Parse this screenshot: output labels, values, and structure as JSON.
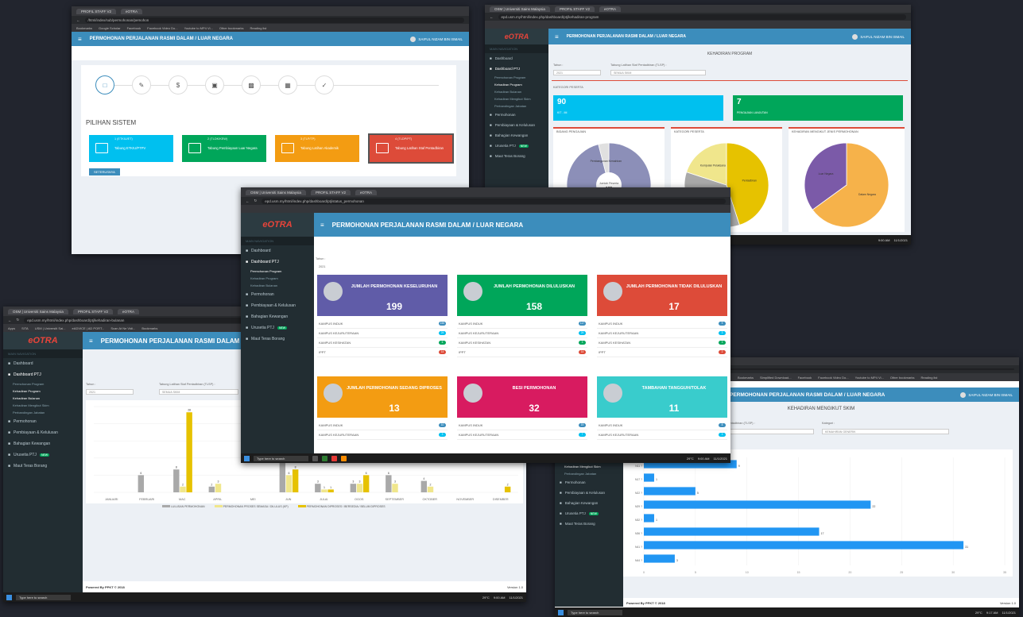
{
  "app": {
    "header_title": "PERMOHONAN PERJALANAN RASMI DALAM / LUAR NEGARA",
    "logo_text": "eOTRA",
    "user_name": "SAIFUL NIZAM BIN ISMAIL",
    "footer": "Powered By PPKT © 2018",
    "version": "Version 1.0",
    "accent_color": "#3c8dbc",
    "sidebar_bg": "#222d32"
  },
  "shot_a": {
    "tabs": [
      "PROFIL STAFF V2",
      "eOTRA"
    ],
    "url": "/html/index/sub/permohonan/pemohon",
    "bookmarks": [
      "Bookmarks",
      "Google Scholar",
      "Facebook",
      "Facebook Video Do...",
      "Youtube to MP4 Vi...",
      "Other bookmarks",
      "Reading list"
    ],
    "section_title": "PILIHAN SISTEM",
    "steps": [
      "file-icon",
      "pen-icon",
      "dollar-icon",
      "image-icon",
      "printer-icon",
      "calendar-icon",
      "check-icon"
    ],
    "cards": [
      {
        "head": "1 (ETKIU/ET)",
        "label": "Tabung ETKIU/PTPV",
        "color": "#00c0ef",
        "icon": "id-card-icon"
      },
      {
        "head": "2 (TLDK/KEW)",
        "label": "Tabung Pembiayaan Luar Negara",
        "color": "#00a65a",
        "icon": "calendar-check-icon"
      },
      {
        "head": "3 (TLP/TP)",
        "label": "Tabung Latihan Akademik",
        "color": "#f39c12",
        "icon": "document-icon"
      },
      {
        "head": "4 (TLDP/PT)",
        "label": "Tabung Latihan Staf Pentadbiran",
        "color": "#dd4b39",
        "icon": "calendar-icon"
      }
    ],
    "next_button": "SETERUSNYA"
  },
  "shot_b": {
    "tabs": [
      "OSM | Universiti Sains Malaysia",
      "PROFIL STAFF V2",
      "eOTRA"
    ],
    "url": "epd.usm.my/html/index.php/dashboard/ptj/kehadiran-program",
    "page_title": "KEHADIRAN PROGRAM",
    "filter_tahun": "Tahun :",
    "filter_tahun_value": "2021",
    "filter_tabung": "Tabung Latihan Staf Pentadbiran (TLSP) :",
    "filter_tabung_value": "SEMUA SKIM",
    "section": "KATEGORI PESERTA",
    "stats": [
      {
        "value": "90",
        "label": "KIT - IM",
        "color": "#00c0ef"
      },
      {
        "value": "7",
        "label": "PENGAJIAN LANJUTAN",
        "color": "#00a65a"
      }
    ],
    "charts": [
      {
        "title": "BIDANG PENGAJIAN",
        "center_label": "Jumlah Peserta",
        "center_value": "105"
      },
      {
        "title": "KATEGORI PESERTA",
        "center_label": "",
        "center_value": ""
      },
      {
        "title": "KEHADIRAN MENGIKUT JENIS PERMOHONAN",
        "center_label": "",
        "center_value": ""
      }
    ],
    "taskbar_search": "Type here to search",
    "time": "9:00 AM",
    "date": "11/1/2021"
  },
  "shot_c": {
    "tabs": [
      "OSM | Universiti Sains Malaysia",
      "PROFIL STAFF V2",
      "eOTRA"
    ],
    "url": "epd.usm.my/html/index.php/dashboard/ptj/status_permohonan",
    "tahun_label": "Tahun :",
    "tahun_value": "2021",
    "stat_cards": [
      {
        "title": "JUMLAH PERMOHONAN KESELURUHAN",
        "value": "199",
        "color": "#605ca8",
        "rows": [
          [
            "KAMPUS INDUK",
            "155"
          ],
          [
            "KAMPUS KEJURUTERAAN",
            "24"
          ],
          [
            "KAMPUS KESIHATAN",
            "6"
          ],
          [
            "IPPT",
            "14"
          ]
        ]
      },
      {
        "title": "JUMLAH PERMOHONAN DILULUSKAN",
        "value": "158",
        "color": "#00a65a",
        "rows": [
          [
            "KAMPUS INDUK",
            "117"
          ],
          [
            "KAMPUS KEJURUTERAAN",
            "24"
          ],
          [
            "KAMPUS KESIHATAN",
            "3"
          ],
          [
            "IPPT",
            "14"
          ]
        ]
      },
      {
        "title": "JUMLAH PERMOHONAN TIDAK DILULUSKAN",
        "value": "17",
        "color": "#dd4b39",
        "rows": [
          [
            "KAMPUS INDUK",
            "9"
          ],
          [
            "KAMPUS KEJURUTERAAN",
            "3"
          ],
          [
            "KAMPUS KESIHATAN",
            "3"
          ],
          [
            "IPPT",
            "2"
          ]
        ]
      },
      {
        "title": "JUMLAH PERMOHONAN SEDANG DIPROSES",
        "value": "13",
        "color": "#f39c12",
        "rows": [
          [
            "KAMPUS INDUK",
            "10"
          ],
          [
            "KAMPUS KEJURUTERAAN",
            "3"
          ]
        ]
      },
      {
        "title": "BESI PERMOHONAN",
        "value": "32",
        "color": "#d81b60",
        "rows": [
          [
            "KAMPUS INDUK",
            "19"
          ],
          [
            "KAMPUS KEJURUTERAAN",
            "7"
          ]
        ]
      },
      {
        "title": "TAMBAHAN TANGGUH/TOLAK",
        "value": "11",
        "color": "#39cccc",
        "rows": [
          [
            "KAMPUS INDUK",
            "8"
          ],
          [
            "KAMPUS KEJURUTERAAN",
            "3"
          ]
        ]
      }
    ],
    "taskbar_search": "Type here to search",
    "temp": "29°C",
    "time": "9:00 AM",
    "date": "11/1/2021"
  },
  "shot_d": {
    "tabs": [
      "OSM | Universiti Sains Malaysia",
      "PROFIL STAFF V2",
      "eOTRA"
    ],
    "url": "epd.usm.my/html/index.php/dashboard/ptj/kehadiran-bulanan",
    "bookmarks": [
      "Apps",
      "SITA",
      "USM | Universiti Sai...",
      "eADVICE | AD PORT...",
      "Scan At Ne Vidi...",
      "Bookmarks"
    ],
    "tahun_label": "Tahun :",
    "tahun_value": "2021",
    "tabung_label": "Tabung Latihan Staf Pentadbiran (TLSP) :",
    "tabung_value": "SEMUA SKIM",
    "legend": [
      "LULUSAN PERMOHONAN",
      "PERMOHONAN PROSES SEMASA / DILULUS (KP)",
      "PERMOHONAN DIPROSES / BERSEDIA / BELUM DIPROSES"
    ],
    "taskbar_search": "Type here to search",
    "temp": "29°C",
    "time": "9:00 AM",
    "date": "11/1/2021"
  },
  "shot_e": {
    "bookmarks": [
      "Bookmarks",
      "Simplified Download...",
      "Facebook",
      "Facebook Video Do...",
      "Youtube to MP4 Vi...",
      "Other bookmarks",
      "Reading list"
    ],
    "page_title": "KEHADIRAN MENGIKUT SKIM",
    "tabung_label": "Pentadbiran (TLSP) :",
    "kategori_label": "Kategori :",
    "kategori_value": "KEMAHIRAN GENERIK",
    "taskbar_search": "Type here to search",
    "temp": "29°C",
    "time": "9:17 AM",
    "date": "11/1/2021"
  },
  "sidebar": {
    "header": "MAIN NAVIGATION",
    "items": [
      "Dashboard",
      "Dashboard PTJ",
      "Permohonan",
      "Pembiayaan & Kelulusan",
      "Bahagian Kewangan",
      "Urusetia PTJ",
      "Maut Teras Borang"
    ],
    "subitems": [
      "Permohonan Program",
      "Kehadiran Program",
      "Kehadiran Bulanan",
      "Kehadiran Mengikut Skim",
      "Perbandingan Jabatan"
    ],
    "new_badge": "NEW"
  },
  "chart_data": [
    {
      "type": "bar",
      "title": "",
      "categories": [
        "JANUARI",
        "FEBRUARI",
        "MAC",
        "APRIL",
        "MEI",
        "JUN",
        "JULAI",
        "OGOS",
        "SEPTEMBER",
        "OKTOBER",
        "NOVEMBER",
        "DISEMBER"
      ],
      "series": [
        {
          "name": "LULUSAN PERMOHONAN",
          "color": "#a9a9a9",
          "values": [
            0,
            6,
            8,
            2,
            0,
            11,
            3,
            3,
            6,
            4,
            0,
            0
          ]
        },
        {
          "name": "PERMOHONAN PROSES SEMASA / DILULUS (KP)",
          "color": "#f0e68c",
          "values": [
            0,
            0,
            2,
            3,
            0,
            6,
            1,
            3,
            3,
            2,
            0,
            0
          ]
        },
        {
          "name": "PERMOHONAN DIPROSES / BERSEDIA / BELUM DIPROSES",
          "color": "#e6c200",
          "values": [
            0,
            0,
            28,
            0,
            0,
            8,
            1,
            6,
            0,
            0,
            0,
            2
          ]
        }
      ],
      "ylim": [
        0,
        30
      ]
    },
    {
      "type": "bar",
      "orientation": "horizontal",
      "title": "",
      "categories": [
        "N11 ?",
        "N17 ?",
        "N22 ?",
        "N29 ?",
        "N32 ?",
        "N36 ?",
        "N41 ?",
        "N44 ?"
      ],
      "values": [
        9,
        1,
        5,
        22,
        1,
        17,
        31,
        3
      ],
      "xlim": [
        0,
        35
      ],
      "color": "#2196f3"
    },
    {
      "type": "pie",
      "title": "BIDANG PENGAJIAN",
      "categories": [
        "Lain-lain",
        "Pembangunan Kemahiran"
      ],
      "values": [
        96,
        4
      ],
      "colors": [
        "#8c8fb8",
        "#e0e0e0"
      ]
    },
    {
      "type": "pie",
      "title": "KATEGORI PESERTA",
      "categories": [
        "Pentadbiran",
        "Akademik",
        "Kumpulan Pelaksana"
      ],
      "values": [
        45,
        35,
        20
      ],
      "colors": [
        "#e6c200",
        "#a9a9a9",
        "#f0e68c"
      ]
    },
    {
      "type": "pie",
      "title": "KEHADIRAN MENGIKUT JENIS PERMOHONAN",
      "categories": [
        "Dalam Negara",
        "Luar Negara"
      ],
      "values": [
        65,
        35
      ],
      "colors": [
        "#f6b24a",
        "#7b5aa8"
      ]
    }
  ]
}
